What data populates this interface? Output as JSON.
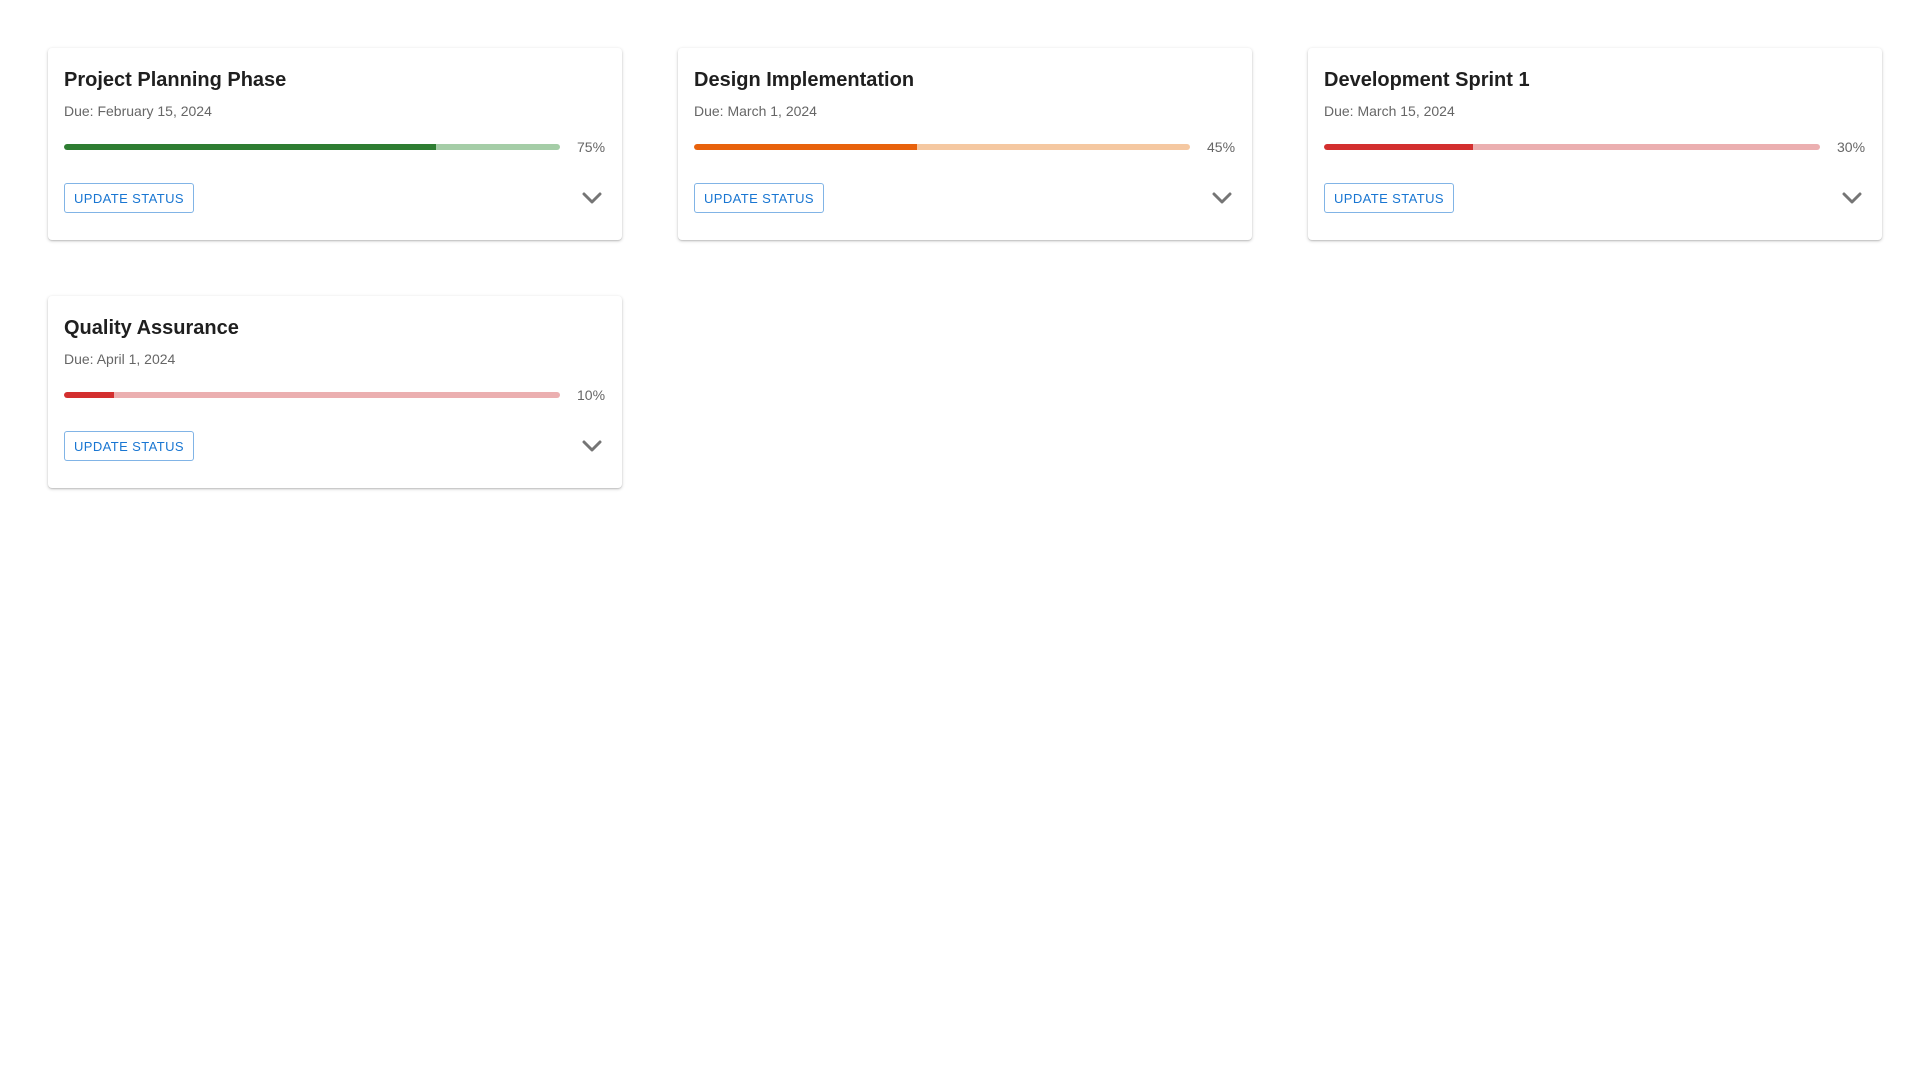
{
  "cards": [
    {
      "title": "Project Planning Phase",
      "due": "Due: February 15, 2024",
      "progress": 75,
      "progress_label": "75%",
      "status_color": "#2e7d32",
      "track_color": "#a5cda7",
      "button_label": "Update Status",
      "expand_icon": "chevron-down-icon"
    },
    {
      "title": "Design Implementation",
      "due": "Due: March 1, 2024",
      "progress": 45,
      "progress_label": "45%",
      "status_color": "#e8620c",
      "track_color": "#f5c8a1",
      "button_label": "Update Status",
      "expand_icon": "chevron-down-icon"
    },
    {
      "title": "Development Sprint 1",
      "due": "Due: March 15, 2024",
      "progress": 30,
      "progress_label": "30%",
      "status_color": "#d32f2f",
      "track_color": "#ebafb0",
      "button_label": "Update Status",
      "expand_icon": "chevron-down-icon"
    },
    {
      "title": "Quality Assurance",
      "due": "Due: April 1, 2024",
      "progress": 10,
      "progress_label": "10%",
      "status_color": "#d32f2f",
      "track_color": "#ebafb0",
      "button_label": "Update Status",
      "expand_icon": "chevron-down-icon"
    }
  ],
  "colors": {
    "button_accent": "#1976d2",
    "icon": "#757575"
  }
}
